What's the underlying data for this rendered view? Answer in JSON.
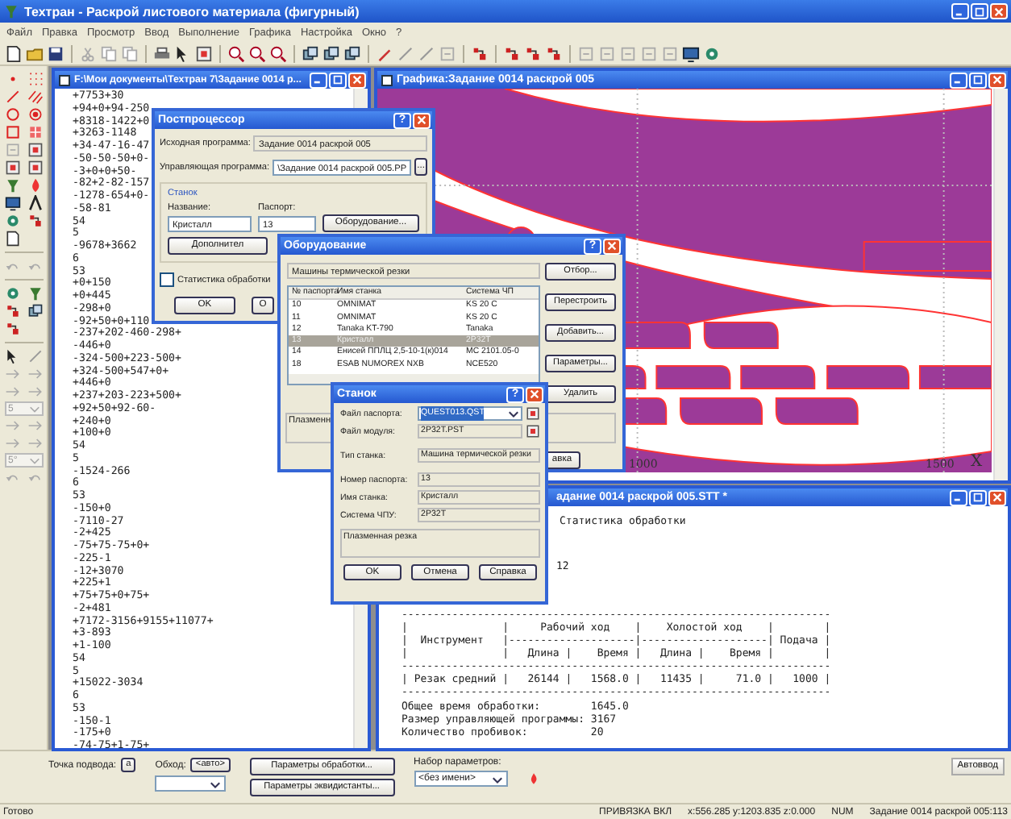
{
  "app": {
    "title": "Техтран - Раскрой листового материала (фигурный)"
  },
  "menu": [
    "Файл",
    "Правка",
    "Просмотр",
    "Ввод",
    "Выполнение",
    "Графика",
    "Настройка",
    "Окно",
    "?"
  ],
  "palette": {
    "dropdowns": [
      "5",
      "5°"
    ]
  },
  "editor": {
    "title": "F:\\Мои документы\\Техтран 7\\Задание 0014 р...",
    "lines": [
      "+7753+30",
      "+94+0+94-250",
      "+8318-1422+0",
      "+3263-1148",
      "+34-47-16-47",
      "-50-50-50+0-",
      "-3+0+0+50-",
      "-82+2-82-157",
      "-1278-654+0-",
      "-58-81",
      "54",
      "5",
      "-9678+3662",
      "6",
      "53",
      "+0+150",
      "+0+445",
      "-298+0",
      "-92+50+0+110",
      "-237+202-460-298+",
      "-446+0",
      "-324-500+223-500+",
      "+324-500+547+0+",
      "+446+0",
      "+237+203-223+500+",
      "+92+50+92-60-",
      "+240+0",
      "+100+0",
      "54",
      "5",
      "-1524-266",
      "6",
      "53",
      "-150+0",
      "-7110-27",
      "-2+425",
      "-75+75-75+0+",
      "-225-1",
      "-12+3070",
      "+225+1",
      "+75+75+0+75+",
      "-2+481",
      "+7172-3156+9155+11077+",
      "+3-893",
      "+1-100",
      "54",
      "5",
      "+15022-3034",
      "6",
      "53",
      "-150-1",
      "-175+0",
      "-74-75+1-75+"
    ]
  },
  "graphics": {
    "title": "Графика:Задание 0014 раскрой 005",
    "axis_labels": [
      "1000",
      "1500",
      "X"
    ]
  },
  "report": {
    "title": "адание 0014 раскрой 005.STT *",
    "heading": "Статистика обработки",
    "value": "12",
    "table": [
      "--------------------------------------------------------------------",
      "|               |     Рабочий ход    |    Холостой ход    |        |",
      "|  Инструмент   |--------------------|--------------------| Подача |",
      "|               |   Длина |    Время |   Длина |    Время |        |",
      "--------------------------------------------------------------------",
      "| Резак средний |   26144 |   1568.0 |   11435 |     71.0 |   1000 |",
      "--------------------------------------------------------------------"
    ],
    "summary": [
      "Общее время обработки:        1645.0",
      "Размер управляющей программы: 3167",
      "Количество пробивок:          20"
    ]
  },
  "postprocessor": {
    "title": "Постпроцессор",
    "help_button": "?",
    "source_label": "Исходная программа:",
    "source_value": "Задание 0014 раскрой 005",
    "control_label": "Управляющая программа:",
    "control_value": "\\Задание 0014 раскрой 005.PP",
    "browse_button": "...",
    "group": "Станок",
    "name_label": "Название:",
    "name_value": "Кристалл",
    "passport_label": "Паспорт:",
    "passport_value": "13",
    "equipment_button": "Оборудование...",
    "extra_button": "Дополнител",
    "statistics": {
      "label": "Статистика обработки",
      "checked": false
    },
    "buttons": [
      "OK",
      "О"
    ]
  },
  "equipment": {
    "title": "Оборудование",
    "help_button": "?",
    "category": "Машины термической резки",
    "columns": [
      "№ паспорта",
      "Имя станка",
      "Система ЧП"
    ],
    "rows": [
      {
        "cells": [
          "10",
          "OMNIMAT",
          "KS 20 C"
        ],
        "selected": false
      },
      {
        "cells": [
          "11",
          "OMNIMAT",
          "KS 20 C"
        ],
        "selected": false
      },
      {
        "cells": [
          "12",
          "Tanaka KT-790",
          "Tanaka"
        ],
        "selected": false
      },
      {
        "cells": [
          "13",
          "Кристалл",
          "2P32T"
        ],
        "selected": true
      },
      {
        "cells": [
          "14",
          "Енисей ППЛЦ 2,5-10-1(к)014",
          "MC 2101.05-0"
        ],
        "selected": false
      },
      {
        "cells": [
          "18",
          "ESAB NUMOREX NXB",
          "NCE520"
        ],
        "selected": false
      }
    ],
    "buttons": [
      "Отбор...",
      "Перестроить",
      "Добавить...",
      "Параметры...",
      "Удалить"
    ],
    "description": "Плазменн",
    "partial_button": "авка"
  },
  "machine": {
    "title": "Станок",
    "help_button": "?",
    "passport_file_label": "Файл паспорта:",
    "passport_file": "QUEST013.QST",
    "passport_file_highlighted": true,
    "module_file_label": "Файл модуля:",
    "module_file": "2P32T.PST",
    "type_label": "Тип станка:",
    "type": "Машина термической резки",
    "number_label": "Номер паспорта:",
    "number": "13",
    "name_label": "Имя станка:",
    "name": "Кристалл",
    "cnc_label": "Система ЧПУ:",
    "cnc": "2P32T",
    "description": "Плазменная резка",
    "buttons": [
      "OK",
      "Отмена",
      "Справка"
    ]
  },
  "bottom_panel": {
    "approach_label": "Точка подвода:",
    "approach_button": "a",
    "bypass_label": "Обход:",
    "bypass_button": "<авто>",
    "process_button": "Параметры обработки...",
    "offset_button": "Параметры эквидистанты...",
    "preset_label": "Набор параметров:",
    "preset_value": "<без имени>",
    "autoinput_button": "Автоввод"
  },
  "status_bar": [
    "Готово",
    "ПРИВЯЗКА ВКЛ",
    "x:556.285 y:1203.835 z:0.000",
    "NUM",
    "Задание 0014 раскрой 005:113"
  ]
}
